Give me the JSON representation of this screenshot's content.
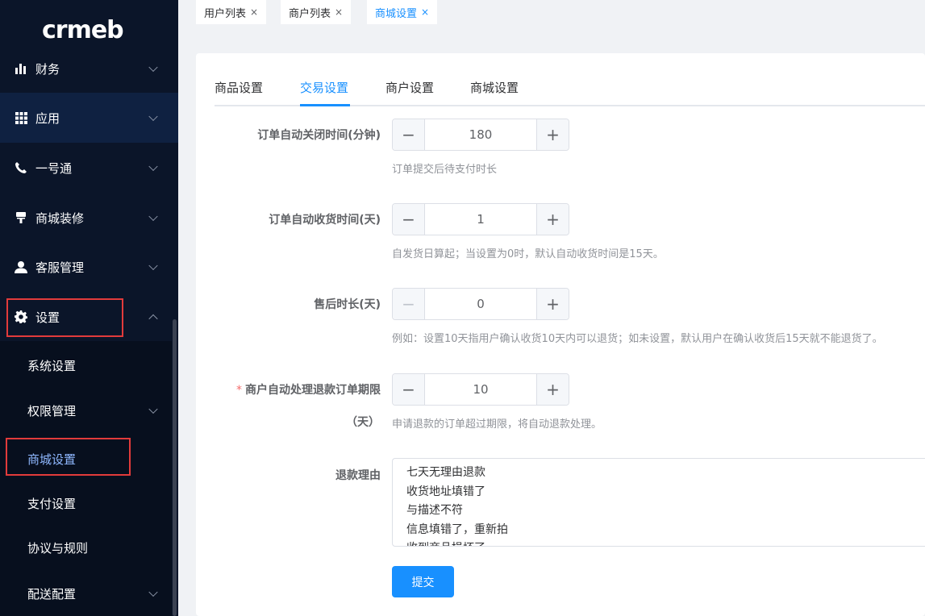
{
  "logo": {
    "text": "crmeb"
  },
  "sidebar": {
    "items": [
      {
        "label": "财务",
        "icon": "bar-chart-icon"
      },
      {
        "label": "应用",
        "icon": "grid-icon"
      },
      {
        "label": "一号通",
        "icon": "phone-icon"
      },
      {
        "label": "商城装修",
        "icon": "paint-roller-icon"
      },
      {
        "label": "客服管理",
        "icon": "user-icon"
      },
      {
        "label": "设置",
        "icon": "gear-icon"
      }
    ],
    "sub_items": [
      {
        "label": "系统设置"
      },
      {
        "label": "权限管理"
      },
      {
        "label": "商城设置"
      },
      {
        "label": "支付设置"
      },
      {
        "label": "协议与规则"
      },
      {
        "label": "配送配置"
      }
    ]
  },
  "top_tags": [
    {
      "label": "用户列表"
    },
    {
      "label": "商户列表"
    },
    {
      "label": "商城设置"
    }
  ],
  "inner_tabs": [
    {
      "label": "商品设置"
    },
    {
      "label": "交易设置"
    },
    {
      "label": "商户设置"
    },
    {
      "label": "商城设置"
    }
  ],
  "form": {
    "order_close": {
      "label": "订单自动关闭时间(分钟)",
      "value": "180",
      "hint": "订单提交后待支付时长"
    },
    "order_receive": {
      "label": "订单自动收货时间(天)",
      "value": "1",
      "hint": "自发货日算起；当设置为0时，默认自动收货时间是15天。"
    },
    "after_sale": {
      "label": "售后时长(天)",
      "value": "0",
      "hint": "例如：设置10天指用户确认收货10天内可以退货；如未设置，默认用户在确认收货后15天就不能退货了。"
    },
    "refund_period": {
      "label_line1": "商户自动处理退款订单期限",
      "label_line2": "（天）",
      "value": "10",
      "hint": "申请退款的订单超过期限，将自动退款处理。",
      "required_mark": "*"
    },
    "refund_reason": {
      "label": "退款理由",
      "lines": [
        "七天无理由退款",
        "收货地址填错了",
        "与描述不符",
        "信息填错了，重新拍",
        "收到商品损坏了"
      ]
    },
    "minus_symbol": "−",
    "plus_symbol": "+",
    "close_symbol": "×",
    "submit_label": "提交"
  },
  "colors": {
    "accent": "#1890ff",
    "sidebar_bg": "#0b1529",
    "highlight_box": "#e23b3b"
  }
}
